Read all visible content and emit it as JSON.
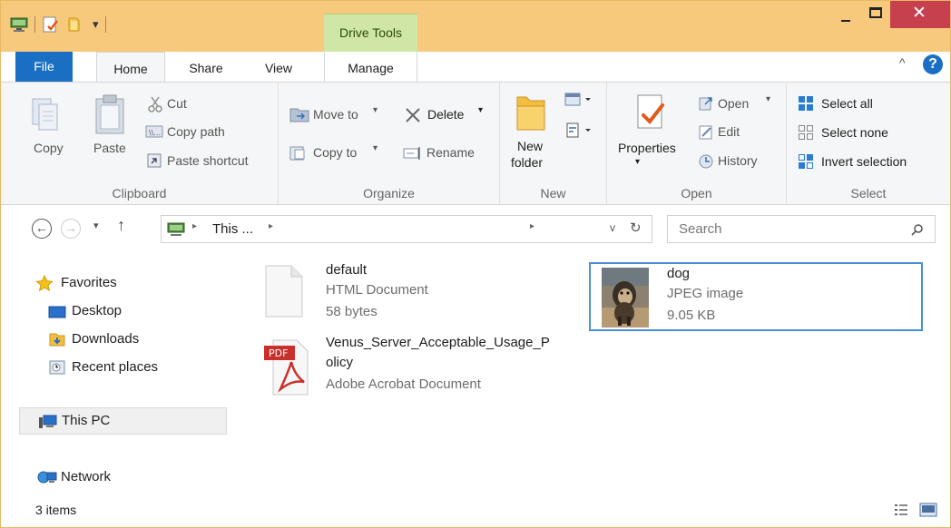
{
  "titlebar": {
    "context_tab": "Drive Tools",
    "close_glyph": "✕"
  },
  "tabs": {
    "file": "File",
    "home": "Home",
    "share": "Share",
    "view": "View",
    "manage": "Manage"
  },
  "ribbon": {
    "clipboard": {
      "copy": "Copy",
      "paste": "Paste",
      "cut": "Cut",
      "copy_path": "Copy path",
      "paste_shortcut": "Paste shortcut",
      "label": "Clipboard"
    },
    "organize": {
      "move_to": "Move to",
      "delete": "Delete",
      "copy_to": "Copy to",
      "rename": "Rename",
      "label": "Organize"
    },
    "new": {
      "new_folder_line1": "New",
      "new_folder_line2": "folder",
      "label": "New"
    },
    "open": {
      "properties": "Properties",
      "open": "Open",
      "edit": "Edit",
      "history": "History",
      "label": "Open"
    },
    "select": {
      "select_all": "Select all",
      "select_none": "Select none",
      "invert_selection": "Invert selection",
      "label": "Select"
    }
  },
  "address": {
    "crumb": "This ...",
    "search_placeholder": "Search"
  },
  "navigation": {
    "favorites": "Favorites",
    "desktop": "Desktop",
    "downloads": "Downloads",
    "recent_places": "Recent places",
    "this_pc": "This PC",
    "network": "Network"
  },
  "files": [
    {
      "name": "default",
      "type": "HTML Document",
      "size": "58 bytes"
    },
    {
      "name_line1": "Venus_Server_Acceptable_Usage_P",
      "name_line2": "olicy",
      "type": "Adobe Acrobat Document",
      "badge": "PDF"
    },
    {
      "name": "dog",
      "type": "JPEG image",
      "size": "9.05 KB"
    }
  ],
  "status": {
    "item_count": "3 items"
  },
  "colors": {
    "titlebar": "#f7c97c",
    "file_tab": "#1a6fc4",
    "drive_tools": "#cfe6a6",
    "close_button": "#c7404d",
    "selection_border": "#4a8fd6"
  }
}
